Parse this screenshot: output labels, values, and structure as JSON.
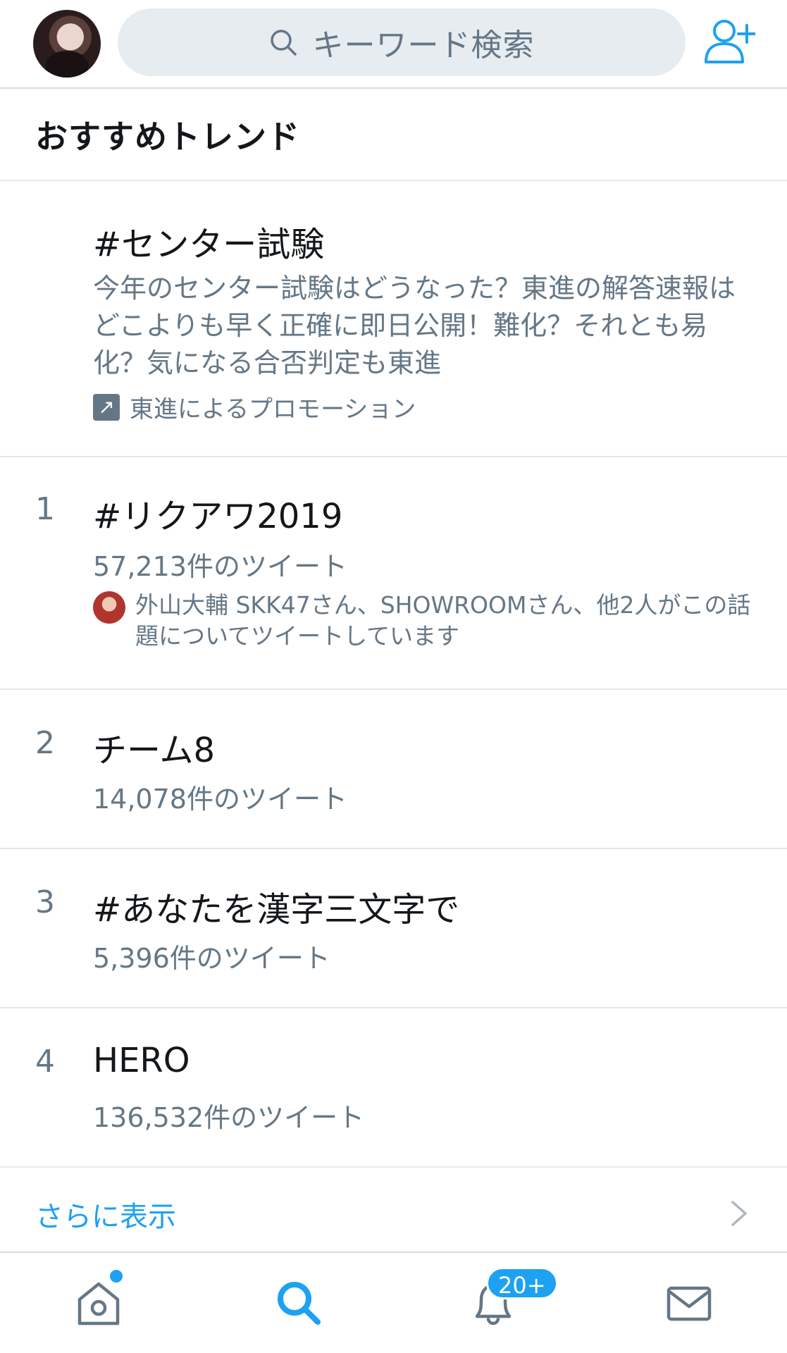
{
  "header": {
    "search_placeholder": "キーワード検索"
  },
  "section_title": "おすすめトレンド",
  "promoted": {
    "name": "#センター試験",
    "description": "今年のセンター試験はどうなった？東進の解答速報はどこよりも早く正確に即日公開！難化？それとも易化？気になる合否判定も東進",
    "promoted_by": "東進によるプロモーション"
  },
  "trends": [
    {
      "rank": "1",
      "name": "#リクアワ2019",
      "count": "57,213件のツイート",
      "context": "外山大輔 SKK47さん、SHOWROOMさん、他2人がこの話題についてツイートしています"
    },
    {
      "rank": "2",
      "name": "チーム8",
      "count": "14,078件のツイート"
    },
    {
      "rank": "3",
      "name": "#あなたを漢字三文字で",
      "count": "5,396件のツイート"
    },
    {
      "rank": "4",
      "name": "HERO",
      "count": "136,532件のツイート"
    }
  ],
  "show_more": "さらに表示",
  "tabbar": {
    "notifications_badge": "20+"
  },
  "colors": {
    "accent": "#1da1f2",
    "secondary_text": "#657786",
    "primary_text": "#14171a",
    "divider": "#e1e8ed"
  },
  "icons": [
    "user-avatar",
    "search-icon",
    "add-user-icon",
    "promoted-arrow-icon",
    "chevron-right-icon",
    "home-icon",
    "explore-search-icon",
    "notifications-bell-icon",
    "messages-envelope-icon"
  ]
}
